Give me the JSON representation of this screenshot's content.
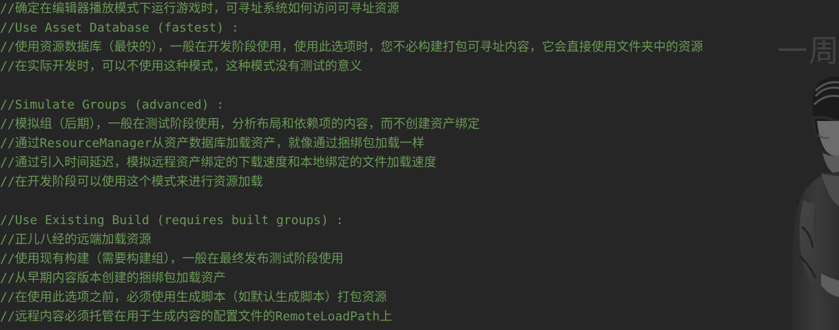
{
  "editor": {
    "lines": [
      "//确定在编辑器播放模式下运行游戏时，可寻址系统如何访问可寻址资源",
      "//Use Asset Database (fastest) :",
      "//使用资源数据库（最快的），一般在开发阶段使用，使用此选项时，您不必构建打包可寻址内容，它会直接使用文件夹中的资源",
      "//在实际开发时，可以不使用这种模式，这种模式没有测试的意义",
      "",
      "//Simulate Groups (advanced) :",
      "//模拟组（后期），一般在测试阶段使用，分析布局和依赖项的内容，而不创建资产绑定",
      "//通过ResourceManager从资产数据库加载资产，就像通过捆绑包加载一样",
      "//通过引入时间延迟，模拟远程资产绑定的下载速度和本地绑定的文件加载速度",
      "//在开发阶段可以使用这个模式来进行资源加载",
      "",
      "//Use Existing Build (requires built groups) :",
      "//正儿八经的远端加载资源",
      "//使用现有构建（需要构建组），一般在最终发布测试阶段使用",
      "//从早期内容版本创建的捆绑包加载资产",
      "//在使用此选项之前，必须使用生成脚本（如默认生成脚本）打包资源",
      "//远程内容必须托管在用于生成内容的配置文件的RemoteLoadPath上"
    ],
    "comment_color": "#6a9955",
    "background_color": "#262626"
  },
  "watermark": {
    "text": "一周"
  },
  "overlay": {
    "icon": "presenter-figure-icon"
  }
}
